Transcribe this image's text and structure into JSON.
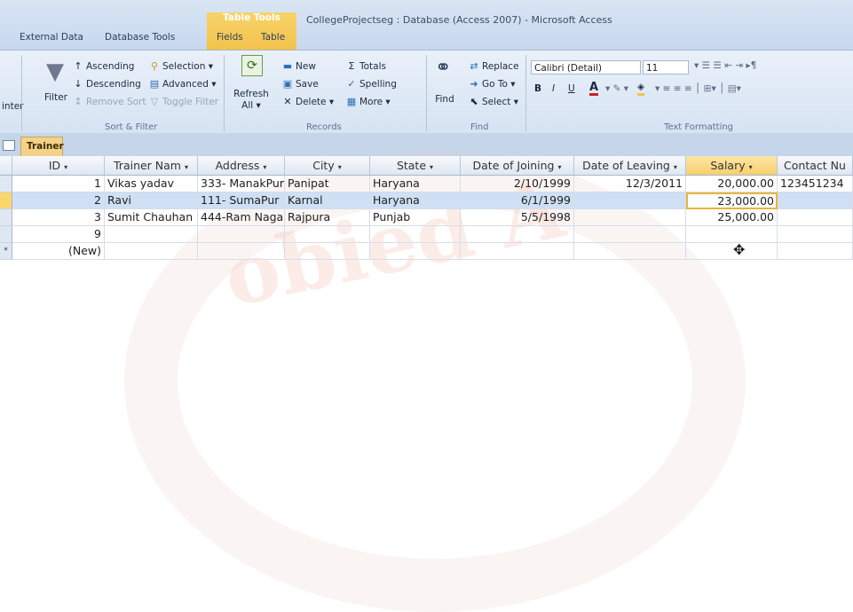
{
  "window": {
    "context_tab_group": "Table Tools",
    "title": "CollegeProjectseg : Database (Access 2007) - Microsoft Access"
  },
  "ribbon_tabs": [
    "External Data",
    "Database Tools",
    "Fields",
    "Table"
  ],
  "ribbon": {
    "sort_filter": {
      "filter": "Filter",
      "ascending": "Ascending",
      "descending": "Descending",
      "remove_sort": "Remove Sort",
      "selection": "Selection ▾",
      "advanced": "Advanced ▾",
      "toggle_filter": "Toggle Filter",
      "group_label": "Sort & Filter"
    },
    "records": {
      "refresh": "Refresh",
      "refresh_all": "All ▾",
      "new": "New",
      "save": "Save",
      "delete": "Delete ▾",
      "totals": "Totals",
      "spelling": "Spelling",
      "more": "More ▾",
      "group_label": "Records"
    },
    "find": {
      "find": "Find",
      "replace": "Replace",
      "goto": "Go To ▾",
      "select": "Select ▾",
      "group_label": "Find"
    },
    "text_formatting": {
      "font": "Calibri (Detail)",
      "size": "11",
      "bold": "B",
      "italic": "I",
      "underline": "U",
      "group_label": "Text Formatting"
    },
    "left_cut_label": "inter"
  },
  "object_tab": "Trainer",
  "columns": [
    "ID",
    "Trainer Nam",
    "Address",
    "City",
    "State",
    "Date of Joining",
    "Date of Leaving",
    "Salary",
    "Contact Nu"
  ],
  "rows": [
    {
      "id": "1",
      "name": "Vikas yadav",
      "address": "333- ManakPur",
      "city": "Panipat",
      "state": "Haryana",
      "doj": "2/10/1999",
      "dol": "12/3/2011",
      "salary": "20,000.00",
      "contact": "123451234"
    },
    {
      "id": "2",
      "name": "Ravi",
      "address": "111- SumaPur",
      "city": "Karnal",
      "state": "Haryana",
      "doj": "6/1/1999",
      "dol": "",
      "salary": "23,000.00",
      "contact": ""
    },
    {
      "id": "3",
      "name": "Sumit Chauhan",
      "address": "444-Ram Nagar",
      "city": "Rajpura",
      "state": "Punjab",
      "doj": "5/5/1998",
      "dol": "",
      "salary": "25,000.00",
      "contact": ""
    },
    {
      "id": "9",
      "name": "",
      "address": "",
      "city": "",
      "state": "",
      "doj": "",
      "dol": "",
      "salary": "",
      "contact": ""
    },
    {
      "id": "(New)",
      "name": "",
      "address": "",
      "city": "",
      "state": "",
      "doj": "",
      "dol": "",
      "salary": "",
      "contact": ""
    }
  ],
  "current_row": 1,
  "colors": {
    "context_tab": "#f3c24b",
    "selected_header": "#f8cf6c",
    "current_row": "#cfe0f5"
  }
}
